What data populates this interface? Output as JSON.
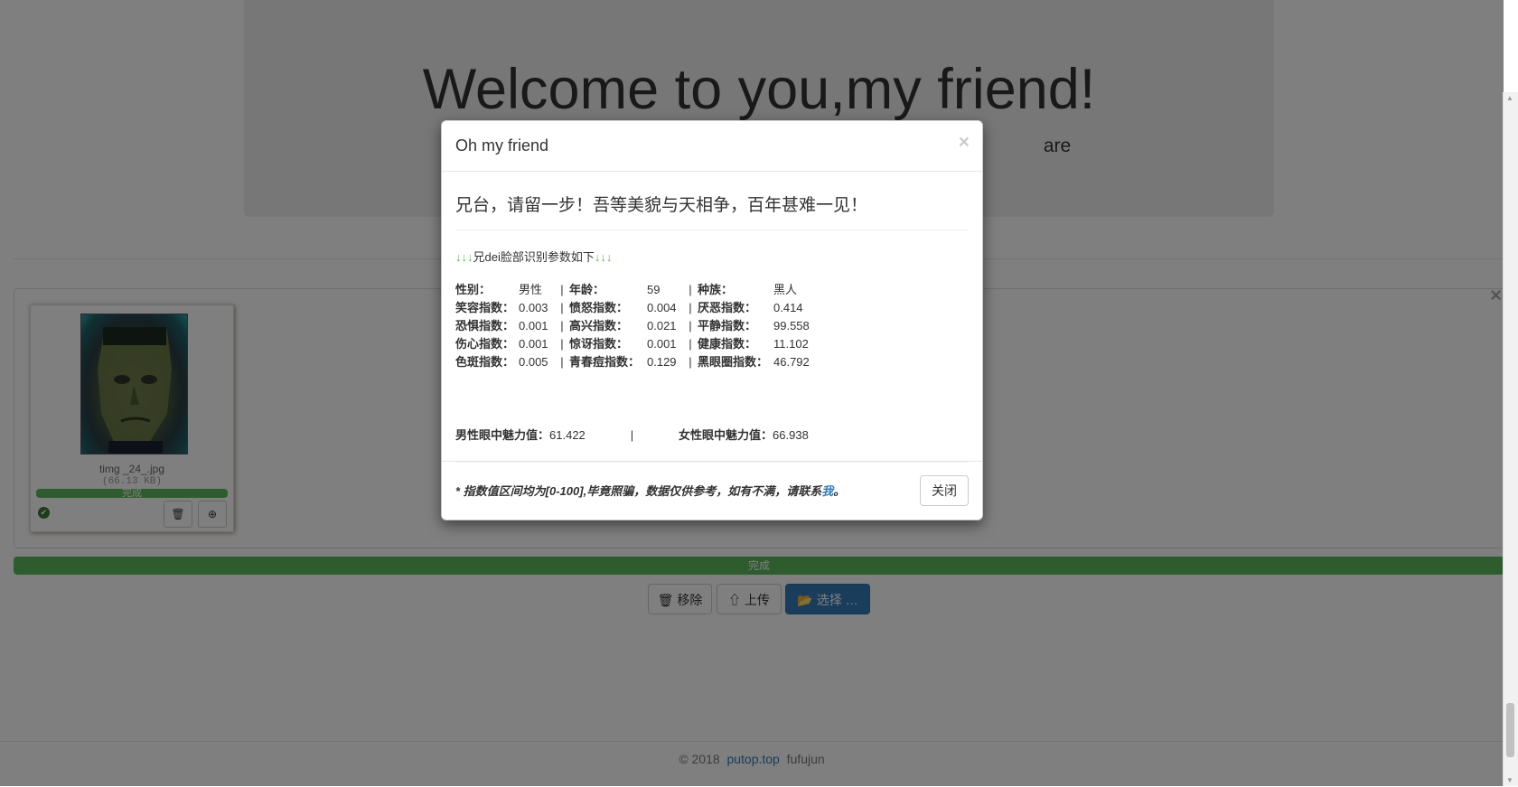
{
  "hero": {
    "title": "Welcome to you,my friend!",
    "subtitle_visible": "are"
  },
  "uploader": {
    "file": {
      "name": "timg _24_.jpg",
      "size": "(66.13 KB)",
      "progress_label": "完成",
      "progress": 1.0
    },
    "overall_progress_label": "完成",
    "overall_progress": 1.0,
    "buttons": {
      "remove": "移除",
      "upload": "上传",
      "browse": "选择 …"
    },
    "close_glyph": "×"
  },
  "footer": {
    "copyright": "© 2018",
    "site": "putop.top",
    "author": "fufujun"
  },
  "modal": {
    "title": "Oh my friend",
    "close_glyph": "×",
    "lead": "兄台，请留一步！吾等美貌与天相争，百年甚难一见！",
    "intro_arrows": "↓↓↓",
    "intro_text": "兄dei脸部识别参数如下",
    "stats": [
      [
        {
          "k": "性别：",
          "v": "男性"
        },
        {
          "k": "年龄：",
          "v": "59"
        },
        {
          "k": "种族：",
          "v": "黑人"
        }
      ],
      [
        {
          "k": "笑容指数：",
          "v": "0.003"
        },
        {
          "k": "愤怒指数：",
          "v": "0.004"
        },
        {
          "k": "厌恶指数：",
          "v": "0.414"
        }
      ],
      [
        {
          "k": "恐惧指数：",
          "v": "0.001"
        },
        {
          "k": "高兴指数：",
          "v": "0.021"
        },
        {
          "k": "平静指数：",
          "v": "99.558"
        }
      ],
      [
        {
          "k": "伤心指数：",
          "v": "0.001"
        },
        {
          "k": "惊讶指数：",
          "v": "0.001"
        },
        {
          "k": "健康指数：",
          "v": "11.102"
        }
      ],
      [
        {
          "k": "色斑指数：",
          "v": "0.005"
        },
        {
          "k": "青春痘指数：",
          "v": "0.129"
        },
        {
          "k": "黑眼圈指数：",
          "v": "46.792"
        }
      ]
    ],
    "separator": "|",
    "male_charm_label": "男性眼中魅力值：",
    "male_charm_value": "61.422",
    "female_charm_label": "女性眼中魅力值：",
    "female_charm_value": "66.938",
    "note_text": "* 指数值区间均为[0-100],毕竟照骗，数据仅供参考，如有不满，请联系",
    "note_link": "我",
    "note_end": "。",
    "close_button": "关闭"
  },
  "colors": {
    "primary": "#337ab7",
    "success": "#5cb85c",
    "backdrop": "#000000"
  }
}
